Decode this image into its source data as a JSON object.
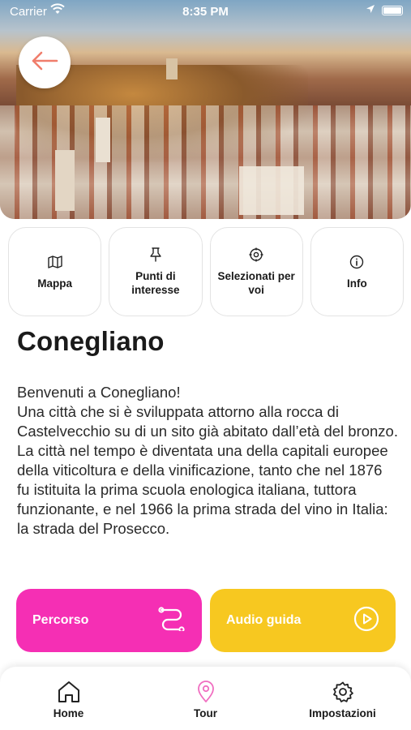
{
  "status_bar": {
    "carrier": "Carrier",
    "time": "8:35 PM"
  },
  "icons": {
    "back": "arrow-left-icon",
    "wifi": "wifi-icon",
    "location": "location-arrow-icon",
    "battery": "battery-icon"
  },
  "quick_nav": [
    {
      "label": "Mappa",
      "icon": "map-icon"
    },
    {
      "label": "Punti di interesse",
      "icon": "pin-icon"
    },
    {
      "label": "Selezionati per voi",
      "icon": "target-icon"
    },
    {
      "label": "Info",
      "icon": "info-icon"
    }
  ],
  "page": {
    "title": "Conegliano",
    "description": "Benvenuti a Conegliano!\nUna città che si è sviluppata attorno alla rocca di Castelvecchio su di un sito già abitato dall’età del bronzo. La città nel tempo è diventata una della capitali europee della viticoltura e della vinificazione, tanto che nel 1876 fu istituita la prima scuola enologica italiana, tuttora funzionante, e nel 1966 la prima strada del vino in Italia: la strada del Prosecco."
  },
  "actions": {
    "route_label": "Percorso",
    "audio_label": "Audio guida"
  },
  "tab_bar": [
    {
      "label": "Home",
      "icon": "home-icon"
    },
    {
      "label": "Tour",
      "icon": "location-pin-icon"
    },
    {
      "label": "Impostazioni",
      "icon": "gear-icon"
    }
  ],
  "colors": {
    "accent": "#f07d6b",
    "route": "#f52fb4",
    "audio": "#f7c820",
    "tour_tab": "#f06ec0"
  }
}
